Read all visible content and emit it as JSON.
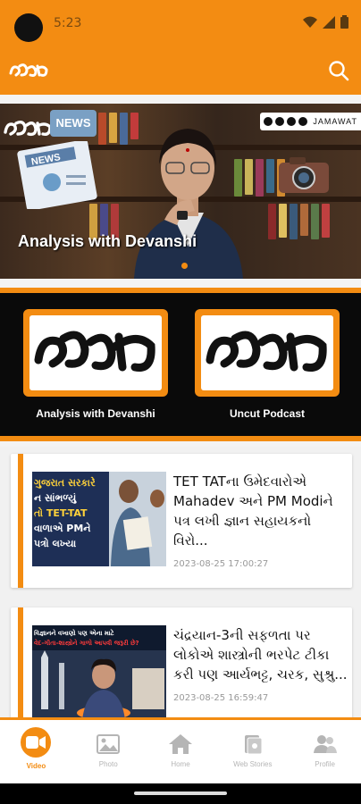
{
  "status_bar": {
    "time": "5:23"
  },
  "hero": {
    "title": "Analysis with Devanshi",
    "news_sign": "NEWS",
    "social_handle": "JAMAWAT"
  },
  "categories": [
    {
      "label": "Analysis with Devanshi"
    },
    {
      "label": "Uncut Podcast"
    }
  ],
  "feed": [
    {
      "title": "TET TATના ઉમેદવારોએ Mahadev અને PM Modiને પત્ર લખી જ્ઞાન સહાયકનો વિરો...",
      "date": "2023-08-25 17:00:27",
      "thumb_text": [
        "ગુજરાત સરકારે",
        "ન સાંભળ્યું",
        "તો TET-TAT",
        "વાળાએ PMને",
        "પત્રો લખ્યા"
      ]
    },
    {
      "title": "ચંદ્રયાન-3ની સફળતા પર લોકોએ શાસ્ત્રોની ભરપેટ ટીકા કરી પણ આર્યભટ્ટ, ચરક, સુશ્રુ...",
      "date": "2023-08-25 16:59:47",
      "thumb_text": [
        "વિજ્ઞાનને વખાણો પણ એના માટે",
        "વેદ-ગીતા-શાસ્ત્રોને ગાળો આપવી જરૂરી છે?"
      ]
    }
  ],
  "bottom_nav": [
    {
      "label": "Video",
      "icon": "video-icon",
      "active": true
    },
    {
      "label": "Photo",
      "icon": "photo-icon",
      "active": false
    },
    {
      "label": "Home",
      "icon": "home-icon",
      "active": false
    },
    {
      "label": "Web Stories",
      "icon": "web-stories-icon",
      "active": false
    },
    {
      "label": "Profile",
      "icon": "profile-icon",
      "active": false
    }
  ],
  "colors": {
    "accent": "#f38c12",
    "dark": "#0a0a0a"
  }
}
